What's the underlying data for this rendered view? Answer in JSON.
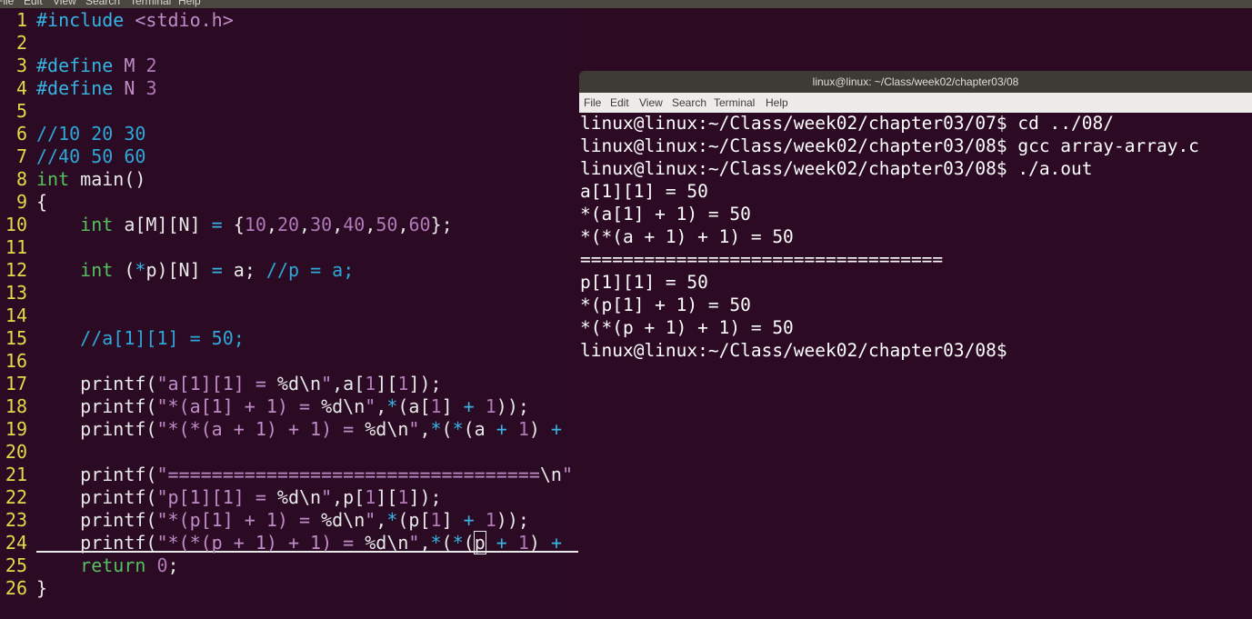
{
  "menubar": {
    "items": [
      "File",
      "Edit",
      "View",
      "Search",
      "Terminal",
      "Help"
    ]
  },
  "editor": {
    "lines": [
      {
        "n": "1",
        "segs": [
          [
            "pp",
            "#include"
          ],
          [
            "",
            " "
          ],
          [
            "str",
            "<stdio.h>"
          ]
        ]
      },
      {
        "n": "2",
        "segs": []
      },
      {
        "n": "3",
        "segs": [
          [
            "pp",
            "#define"
          ],
          [
            "",
            " "
          ],
          [
            "str",
            "M"
          ],
          [
            "",
            " "
          ],
          [
            "num",
            "2"
          ]
        ]
      },
      {
        "n": "4",
        "segs": [
          [
            "pp",
            "#define"
          ],
          [
            "",
            " "
          ],
          [
            "str",
            "N"
          ],
          [
            "",
            " "
          ],
          [
            "num",
            "3"
          ]
        ]
      },
      {
        "n": "5",
        "segs": []
      },
      {
        "n": "6",
        "segs": [
          [
            "cm",
            "//10 20 30"
          ]
        ]
      },
      {
        "n": "7",
        "segs": [
          [
            "cm",
            "//40 50 60"
          ]
        ]
      },
      {
        "n": "8",
        "segs": [
          [
            "ty",
            "int"
          ],
          [
            "",
            " main()"
          ]
        ]
      },
      {
        "n": "9",
        "segs": [
          [
            "",
            "{"
          ]
        ]
      },
      {
        "n": "10",
        "segs": [
          [
            "",
            "    "
          ],
          [
            "ty",
            "int"
          ],
          [
            "",
            " a[M][N] "
          ],
          [
            "op",
            "="
          ],
          [
            "",
            " {"
          ],
          [
            "num",
            "10"
          ],
          [
            "",
            ","
          ],
          [
            "num",
            "20"
          ],
          [
            "",
            ","
          ],
          [
            "num",
            "30"
          ],
          [
            "",
            ","
          ],
          [
            "num",
            "40"
          ],
          [
            "",
            ","
          ],
          [
            "num",
            "50"
          ],
          [
            "",
            ","
          ],
          [
            "num",
            "60"
          ],
          [
            "",
            "};"
          ]
        ]
      },
      {
        "n": "11",
        "segs": []
      },
      {
        "n": "12",
        "segs": [
          [
            "",
            "    "
          ],
          [
            "ty",
            "int"
          ],
          [
            "",
            " ("
          ],
          [
            "op",
            "*"
          ],
          [
            "",
            "p)[N] "
          ],
          [
            "op",
            "="
          ],
          [
            "",
            " a; "
          ],
          [
            "cm",
            "//p = a;"
          ]
        ]
      },
      {
        "n": "13",
        "segs": []
      },
      {
        "n": "14",
        "segs": []
      },
      {
        "n": "15",
        "segs": [
          [
            "",
            "    "
          ],
          [
            "cm",
            "//a[1][1] = 50;"
          ]
        ]
      },
      {
        "n": "16",
        "segs": []
      },
      {
        "n": "17",
        "segs": [
          [
            "",
            "    printf("
          ],
          [
            "str",
            "\"a[1][1] = "
          ],
          [
            "",
            "%d\\n"
          ],
          [
            "str",
            "\""
          ],
          [
            "",
            ",a["
          ],
          [
            "num",
            "1"
          ],
          [
            "",
            "]["
          ],
          [
            "num",
            "1"
          ],
          [
            "",
            "]);"
          ]
        ]
      },
      {
        "n": "18",
        "segs": [
          [
            "",
            "    printf("
          ],
          [
            "str",
            "\"*(a[1] + 1) = "
          ],
          [
            "",
            "%d\\n"
          ],
          [
            "str",
            "\""
          ],
          [
            "",
            ","
          ],
          [
            "op",
            "*"
          ],
          [
            "",
            "(a["
          ],
          [
            "num",
            "1"
          ],
          [
            "",
            "] "
          ],
          [
            "op",
            "+"
          ],
          [
            "",
            " "
          ],
          [
            "num",
            "1"
          ],
          [
            "",
            "));"
          ]
        ]
      },
      {
        "n": "19",
        "segs": [
          [
            "",
            "    printf("
          ],
          [
            "str",
            "\"*(*(a + 1) + 1) = "
          ],
          [
            "",
            "%d\\n"
          ],
          [
            "str",
            "\""
          ],
          [
            "",
            ","
          ],
          [
            "op",
            "*"
          ],
          [
            "",
            "("
          ],
          [
            "op",
            "*"
          ],
          [
            "",
            "(a "
          ],
          [
            "op",
            "+"
          ],
          [
            "",
            " "
          ],
          [
            "num",
            "1"
          ],
          [
            "",
            ") "
          ],
          [
            "op",
            "+"
          ]
        ]
      },
      {
        "n": "20",
        "segs": []
      },
      {
        "n": "21",
        "segs": [
          [
            "",
            "    printf("
          ],
          [
            "str",
            "\"=================================="
          ],
          [
            "",
            "\\n"
          ],
          [
            "str",
            "\""
          ]
        ]
      },
      {
        "n": "22",
        "segs": [
          [
            "",
            "    printf("
          ],
          [
            "str",
            "\"p[1][1] = "
          ],
          [
            "",
            "%d\\n"
          ],
          [
            "str",
            "\""
          ],
          [
            "",
            ",p["
          ],
          [
            "num",
            "1"
          ],
          [
            "",
            "]["
          ],
          [
            "num",
            "1"
          ],
          [
            "",
            "]);"
          ]
        ]
      },
      {
        "n": "23",
        "segs": [
          [
            "",
            "    printf("
          ],
          [
            "str",
            "\"*(p[1] + 1) = "
          ],
          [
            "",
            "%d\\n"
          ],
          [
            "str",
            "\""
          ],
          [
            "",
            ","
          ],
          [
            "op",
            "*"
          ],
          [
            "",
            "(p["
          ],
          [
            "num",
            "1"
          ],
          [
            "",
            "] "
          ],
          [
            "op",
            "+"
          ],
          [
            "",
            " "
          ],
          [
            "num",
            "1"
          ],
          [
            "",
            "));"
          ]
        ]
      },
      {
        "n": "24",
        "segs": [
          [
            "",
            "    printf("
          ],
          [
            "str",
            "\"*(*(p + 1) + 1) = "
          ],
          [
            "",
            "%d\\n"
          ],
          [
            "str",
            "\""
          ],
          [
            "",
            ","
          ],
          [
            "op",
            "*"
          ],
          [
            "",
            "("
          ],
          [
            "op",
            "*"
          ],
          [
            "",
            "("
          ],
          [
            "cursor",
            "p"
          ],
          [
            "",
            " "
          ],
          [
            "op",
            "+"
          ],
          [
            "",
            " "
          ],
          [
            "num",
            "1"
          ],
          [
            "",
            ") "
          ],
          [
            "op",
            "+"
          ]
        ]
      },
      {
        "n": "25",
        "segs": [
          [
            "",
            "    "
          ],
          [
            "ty",
            "return"
          ],
          [
            "",
            " "
          ],
          [
            "num",
            "0"
          ],
          [
            "",
            ";"
          ]
        ]
      },
      {
        "n": "26",
        "segs": [
          [
            "",
            "}"
          ]
        ]
      }
    ]
  },
  "terminal": {
    "title": "linux@linux: ~/Class/week02/chapter03/08",
    "menu": [
      "File",
      "Edit",
      "View",
      "Search",
      "Terminal",
      "Help"
    ],
    "lines": [
      "linux@linux:~/Class/week02/chapter03/07$ cd ../08/",
      "linux@linux:~/Class/week02/chapter03/08$ gcc array-array.c",
      "linux@linux:~/Class/week02/chapter03/08$ ./a.out",
      "a[1][1] = 50",
      "*(a[1] + 1) = 50",
      "*(*(a + 1) + 1) = 50",
      "==================================",
      "p[1][1] = 50",
      "*(p[1] + 1) = 50",
      "*(*(p + 1) + 1) = 50",
      "linux@linux:~/Class/week02/chapter03/08$"
    ]
  }
}
